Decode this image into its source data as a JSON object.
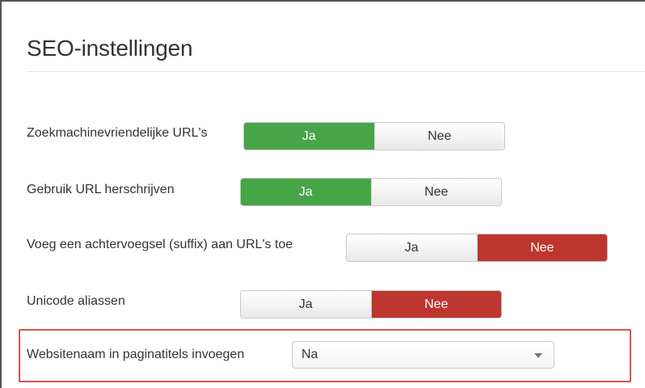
{
  "section": {
    "title": "SEO-instellingen"
  },
  "settings": [
    {
      "label": "Zoekmachinevriendelijke URL's",
      "yes": "Ja",
      "no": "Nee",
      "selected": "yes"
    },
    {
      "label": "Gebruik URL herschrijven",
      "yes": "Ja",
      "no": "Nee",
      "selected": "yes"
    },
    {
      "label": "Voeg een achtervoegsel (suffix) aan URL's toe",
      "yes": "Ja",
      "no": "Nee",
      "selected": "no"
    },
    {
      "label": "Unicode aliassen",
      "yes": "Ja",
      "no": "Nee",
      "selected": "no"
    }
  ],
  "site_name_setting": {
    "label": "Websitenaam in paginatitels invoegen",
    "value": "Na"
  },
  "colors": {
    "yes_active": "#46a546",
    "no_active": "#bd362f",
    "highlight_border": "#d9534f"
  }
}
